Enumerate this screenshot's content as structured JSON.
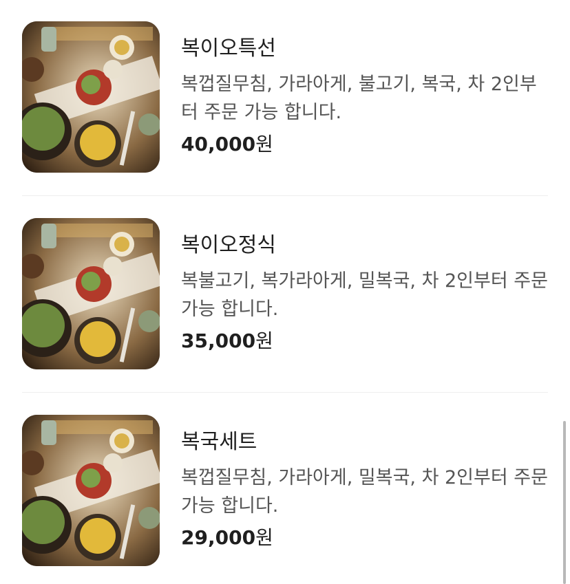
{
  "menu": {
    "items": [
      {
        "name": "복이오특선",
        "description": "복껍질무침, 가라아게, 불고기, 복국, 차 2인부터 주문 가능 합니다.",
        "price": "40,000",
        "currency": "원",
        "image": "food-photo"
      },
      {
        "name": "복이오정식",
        "description": "복불고기, 복가라아게, 밀복국, 차 2인부터 주문 가능 합니다.",
        "price": "35,000",
        "currency": "원",
        "image": "food-photo"
      },
      {
        "name": "복국세트",
        "description": "복껍질무침, 가라아게, 밀복국, 차 2인부터 주문 가능 합니다.",
        "price": "29,000",
        "currency": "원",
        "image": "food-photo"
      }
    ]
  },
  "colors": {
    "text_primary": "#1f1f1f",
    "text_secondary": "#555555",
    "divider": "#eeeeee",
    "scrollbar": "#b8b8b8"
  }
}
